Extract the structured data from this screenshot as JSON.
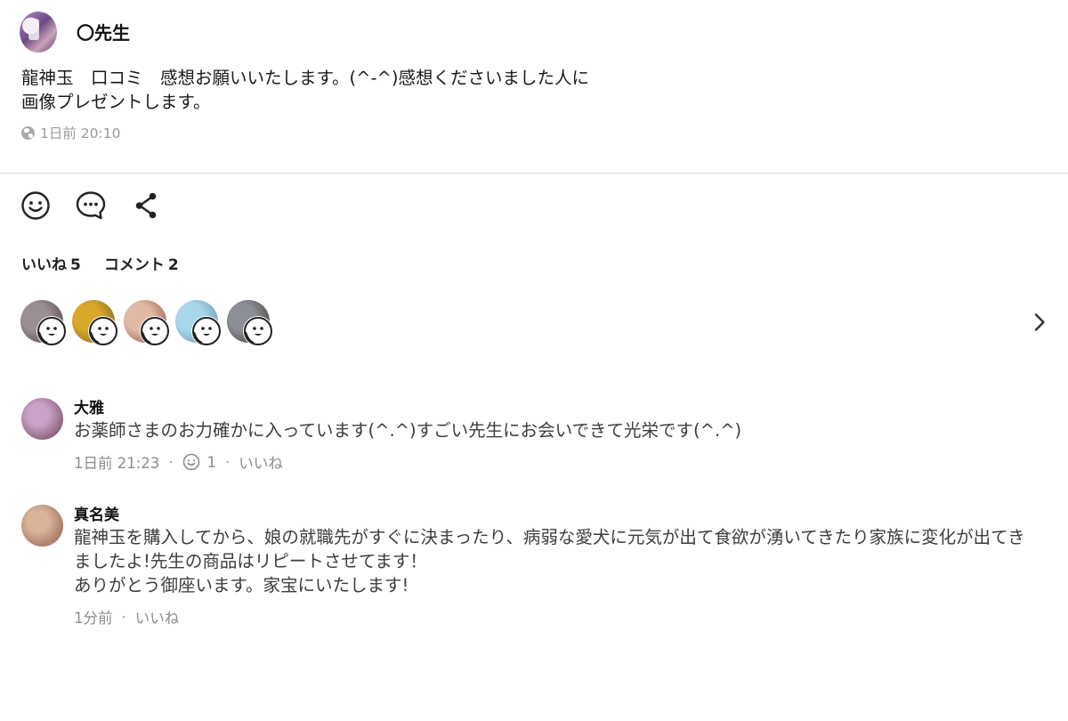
{
  "post": {
    "author": "〇先生",
    "text": "龍神玉　口コミ　感想お願いいたします。(^-^)感想くださいました人に\n画像プレゼントします。",
    "timestamp": "1日前 20:10",
    "visibility_icon": "globe-icon"
  },
  "actions": [
    {
      "icon": "smiley-icon"
    },
    {
      "icon": "comment-bubble-icon"
    },
    {
      "icon": "share-icon"
    }
  ],
  "stats": {
    "likes_label": "いいね",
    "likes_count": "5",
    "comments_label": "コメント",
    "comments_count": "2"
  },
  "likers": [
    {
      "colors": [
        "#9a8f94",
        "#4b3b3c"
      ]
    },
    {
      "colors": [
        "#d9a82a",
        "#6f5a1e"
      ]
    },
    {
      "colors": [
        "#e1b9a6",
        "#8a4b3a"
      ]
    },
    {
      "colors": [
        "#a9d7ea",
        "#5e8aa8"
      ]
    },
    {
      "colors": [
        "#8c8f95",
        "#3b2e2c"
      ]
    }
  ],
  "comments": [
    {
      "name": "大雅",
      "text": "お薬師さまのお力確かに入っています(^.^)すごい先生にお会いできて光栄です(^.^)",
      "time": "1日前 21:23",
      "reaction_count": "1",
      "like_label": "いいね",
      "avatar_colors": [
        "#c9a3c8",
        "#6a3d52"
      ]
    },
    {
      "name": "真名美",
      "text": "龍神玉を購入してから、娘の就職先がすぐに決まったり、病弱な愛犬に元気が出て食欲が湧いてきたり家族に変化が出てき\nましたよ!先生の商品はリピートさせてます！\nありがとう御座います。家宝にいたします!",
      "time": "1分前",
      "like_label": "いいね",
      "avatar_colors": [
        "#d9b39a",
        "#8b5a4a"
      ]
    }
  ]
}
